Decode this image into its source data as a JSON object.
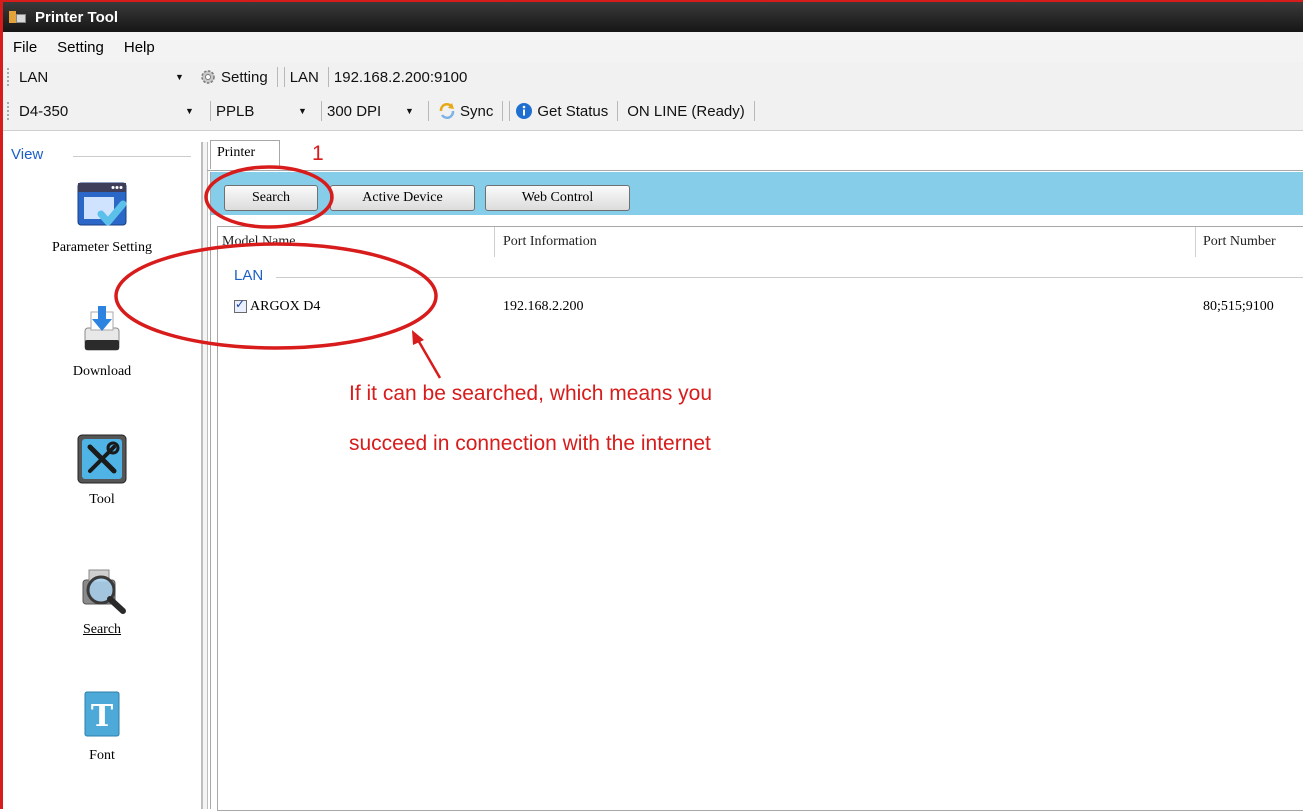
{
  "window": {
    "title": "Printer Tool"
  },
  "menu": {
    "items": [
      "File",
      "Setting",
      "Help"
    ]
  },
  "toolbar1": {
    "port_select": "LAN",
    "setting_label": "Setting",
    "port_type": "LAN",
    "address": "192.168.2.200:9100"
  },
  "toolbar2": {
    "model_select": "D4-350",
    "language_select": "PPLB",
    "dpi_select": "300 DPI",
    "sync_label": "Sync",
    "get_status_label": "Get Status",
    "status_text": "ON LINE (Ready)"
  },
  "sidebar": {
    "header": "View",
    "items": [
      {
        "label": "Parameter Setting",
        "icon": "parameter-setting-icon"
      },
      {
        "label": "Download",
        "icon": "printer-download-icon"
      },
      {
        "label": "Tool",
        "icon": "tools-icon"
      },
      {
        "label": "Search",
        "icon": "search-printer-icon"
      },
      {
        "label": "Font",
        "icon": "font-icon"
      }
    ]
  },
  "tabs": [
    {
      "label": "Printer"
    }
  ],
  "buttons": {
    "search": "Search",
    "active_device": "Active Device",
    "web_control": "Web Control"
  },
  "table": {
    "columns": [
      "Model Name",
      "Port Information",
      "Port Number"
    ],
    "group": "LAN",
    "rows": [
      {
        "model": "ARGOX D4",
        "port_info": "192.168.2.200",
        "port_number": "80;515;9100",
        "checked": true
      }
    ]
  },
  "annotations": {
    "step_number": "1",
    "note_line1": "If it can be searched, which means you",
    "note_line2": "succeed in connection with the internet",
    "color": "#d81b1b"
  },
  "colors": {
    "accent_band": "#86cde9",
    "link_blue": "#1d5fc4",
    "title_bar": "#1e1e1e"
  }
}
